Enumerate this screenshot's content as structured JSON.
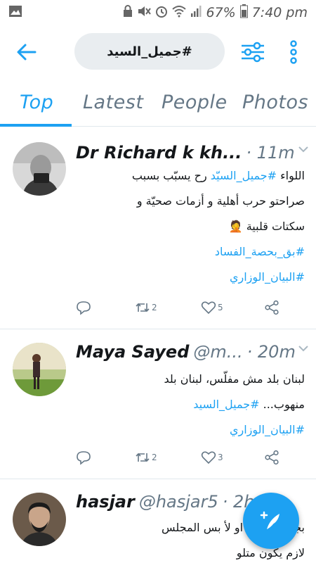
{
  "status_bar": {
    "battery": "67%",
    "time": "7:40 pm"
  },
  "header": {
    "search_query": "#جميل_السيد"
  },
  "tabs": [
    {
      "label": "Top",
      "active": true
    },
    {
      "label": "Latest",
      "active": false
    },
    {
      "label": "People",
      "active": false
    },
    {
      "label": "Photos",
      "active": false
    }
  ],
  "colors": {
    "accent": "#1da1f2",
    "muted": "#657786"
  },
  "tweets": [
    {
      "name": "Dr Richard k kh...",
      "handle": "",
      "time": "· 11m",
      "lines": [
        {
          "plain_after": " رح يسبّب بسبب",
          "tag": "#جميل_السيّد",
          "plain_before": "اللواء "
        },
        {
          "plain": "صراحتو حرب أهلية و أزمات صحيّة و"
        },
        {
          "plain": "سكتات قلبية 🤦"
        },
        {
          "tag": "#بق_بحصة_الفساد"
        },
        {
          "tag": "#البيان_الوزاري"
        }
      ],
      "replies": "",
      "retweets": "2",
      "likes": "5"
    },
    {
      "name": "Maya Sayed",
      "handle": "@m...",
      "time": "· 20m",
      "lines": [
        {
          "plain": "لبنان بلد مش مفلّس، لبنان بلد"
        },
        {
          "plain_before": "منهوب... ",
          "tag": "#جميل_السيد"
        },
        {
          "tag": "#البيان_الوزاري"
        }
      ],
      "replies": "",
      "retweets": "2",
      "likes": "3"
    },
    {
      "name": "hasjar",
      "handle": "@hasjar5",
      "time": "· 2h",
      "lines": [
        {
          "plain": "بجميل السيد او لأ بس المجلس"
        },
        {
          "plain": "لازم يكون متلو"
        }
      ]
    }
  ]
}
